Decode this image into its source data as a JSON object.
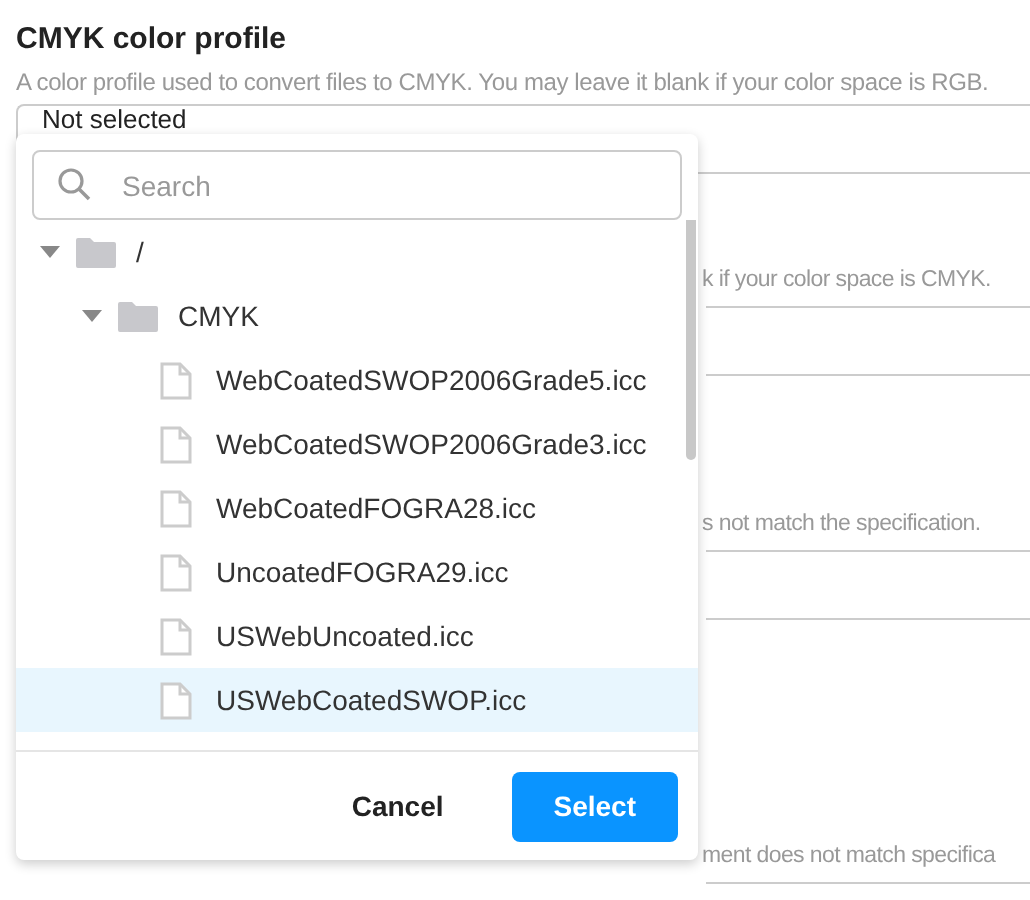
{
  "profile_field": {
    "label": "CMYK color profile",
    "description": "A color profile used to convert files to CMYK. You may leave it blank if your color space is RGB.",
    "value": "Not selected"
  },
  "background_fields": [
    {
      "description": "k if your color space is CMYK."
    },
    {
      "description": "s not match the specification."
    },
    {
      "description": "ment does not match specifica"
    }
  ],
  "picker": {
    "search": {
      "placeholder": "Search"
    },
    "tree": [
      {
        "name": "/",
        "kind": "folder",
        "expanded": true,
        "selected": false,
        "children": [
          {
            "name": "CMYK",
            "kind": "folder",
            "expanded": true,
            "selected": false,
            "children": [
              {
                "name": "WebCoatedSWOP2006Grade5.icc",
                "kind": "file",
                "selected": false
              },
              {
                "name": "WebCoatedSWOP2006Grade3.icc",
                "kind": "file",
                "selected": false
              },
              {
                "name": "WebCoatedFOGRA28.icc",
                "kind": "file",
                "selected": false
              },
              {
                "name": "UncoatedFOGRA29.icc",
                "kind": "file",
                "selected": false
              },
              {
                "name": "USWebUncoated.icc",
                "kind": "file",
                "selected": false
              },
              {
                "name": "USWebCoatedSWOP.icc",
                "kind": "file",
                "selected": true
              }
            ]
          }
        ]
      }
    ],
    "buttons": [
      {
        "label": "Cancel",
        "kind": "secondary"
      },
      {
        "label": "Select",
        "kind": "primary"
      }
    ]
  }
}
